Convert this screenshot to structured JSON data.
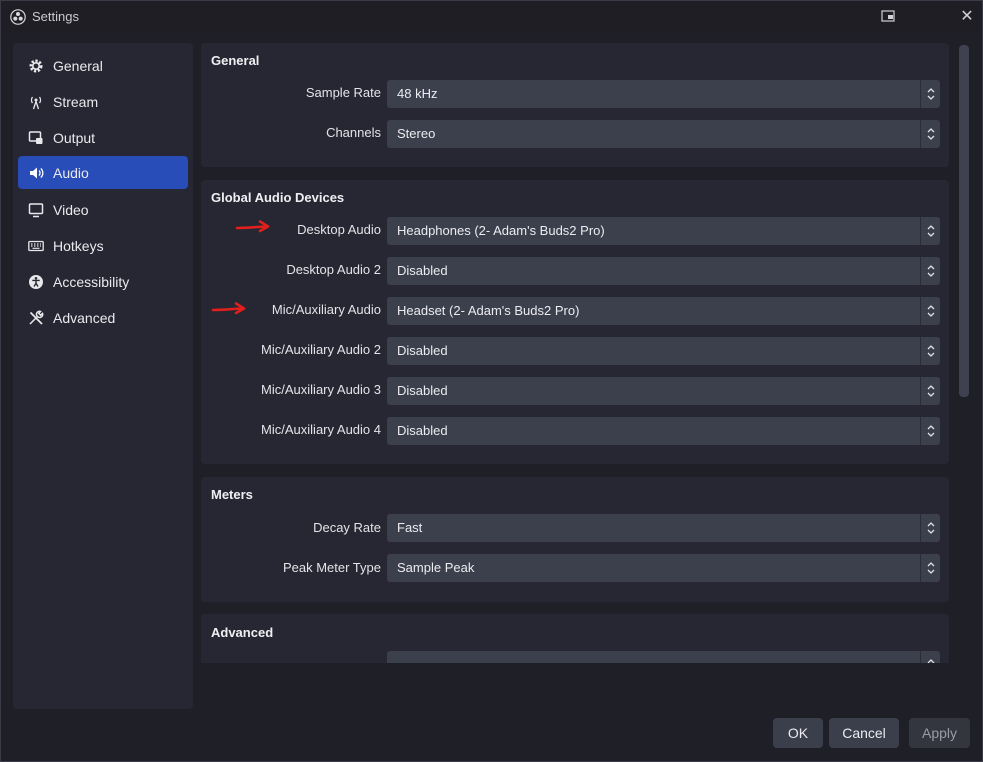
{
  "window": {
    "title": "Settings"
  },
  "sidebar": {
    "items": [
      {
        "label": "General",
        "icon": "gear-icon"
      },
      {
        "label": "Stream",
        "icon": "antenna-icon"
      },
      {
        "label": "Output",
        "icon": "output-icon"
      },
      {
        "label": "Audio",
        "icon": "speaker-icon",
        "active": true
      },
      {
        "label": "Video",
        "icon": "monitor-icon"
      },
      {
        "label": "Hotkeys",
        "icon": "keyboard-icon"
      },
      {
        "label": "Accessibility",
        "icon": "accessibility-icon"
      },
      {
        "label": "Advanced",
        "icon": "tools-icon"
      }
    ]
  },
  "sections": {
    "general": {
      "title": "General",
      "rows": [
        {
          "label": "Sample Rate",
          "value": "48 kHz"
        },
        {
          "label": "Channels",
          "value": "Stereo"
        }
      ]
    },
    "devices": {
      "title": "Global Audio Devices",
      "rows": [
        {
          "label": "Desktop Audio",
          "value": "Headphones (2- Adam's Buds2 Pro)"
        },
        {
          "label": "Desktop Audio 2",
          "value": "Disabled"
        },
        {
          "label": "Mic/Auxiliary Audio",
          "value": "Headset (2- Adam's Buds2 Pro)"
        },
        {
          "label": "Mic/Auxiliary Audio 2",
          "value": "Disabled"
        },
        {
          "label": "Mic/Auxiliary Audio 3",
          "value": "Disabled"
        },
        {
          "label": "Mic/Auxiliary Audio 4",
          "value": "Disabled"
        }
      ]
    },
    "meters": {
      "title": "Meters",
      "rows": [
        {
          "label": "Decay Rate",
          "value": "Fast"
        },
        {
          "label": "Peak Meter Type",
          "value": "Sample Peak"
        }
      ]
    },
    "advanced": {
      "title": "Advanced"
    }
  },
  "buttons": {
    "ok": "OK",
    "cancel": "Cancel",
    "apply": "Apply"
  },
  "colors": {
    "accent": "#284cb8",
    "annotation_arrow": "#e0201c"
  }
}
